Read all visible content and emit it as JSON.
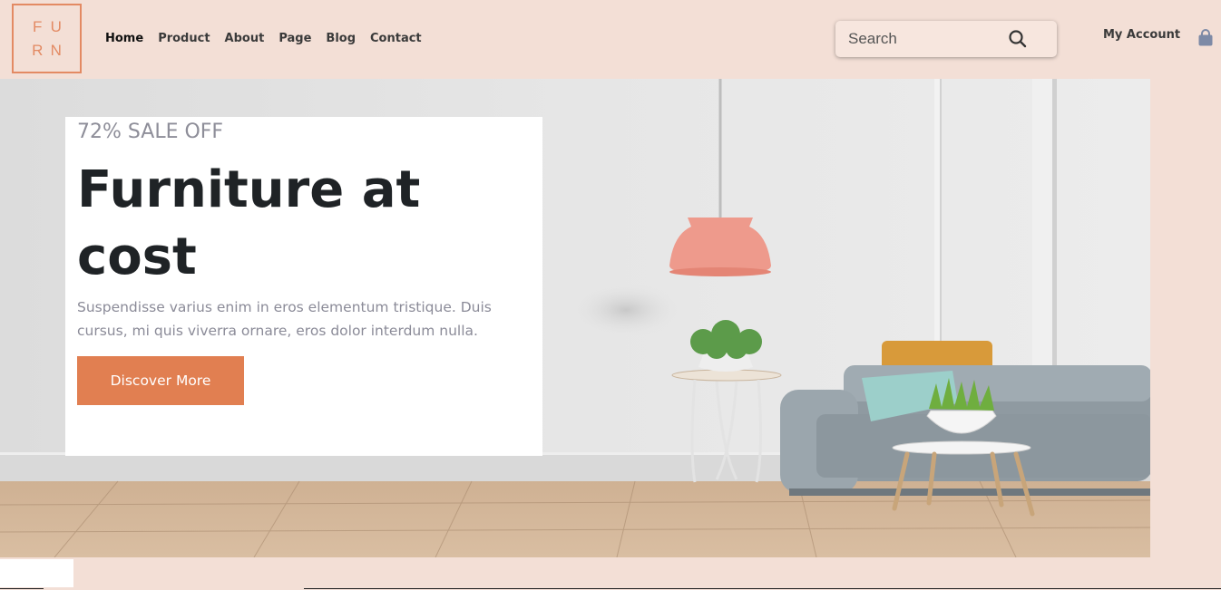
{
  "logo": {
    "letters": [
      "F",
      "U",
      "R",
      "N"
    ]
  },
  "nav": {
    "items": [
      {
        "label": "Home",
        "active": true
      },
      {
        "label": "Product"
      },
      {
        "label": "About"
      },
      {
        "label": "Page"
      },
      {
        "label": "Blog"
      },
      {
        "label": "Contact"
      }
    ]
  },
  "search": {
    "placeholder": "Search",
    "icon": "search-icon"
  },
  "account": {
    "label": "My Account",
    "cart_icon": "shopping-bag-icon"
  },
  "hero": {
    "eyebrow": "72% SALE OFF",
    "title": "Furniture at cost",
    "description": "Suspendisse varius enim in eros elementum tristique. Duis cursus, mi quis viverra ornare, eros dolor interdum nulla.",
    "cta_label": "Discover More"
  },
  "colors": {
    "page_bg": "#f3dfd6",
    "accent": "#e17f51",
    "logo": "#e38a63",
    "heading": "#1f2326",
    "muted_text": "#8b8b98"
  }
}
